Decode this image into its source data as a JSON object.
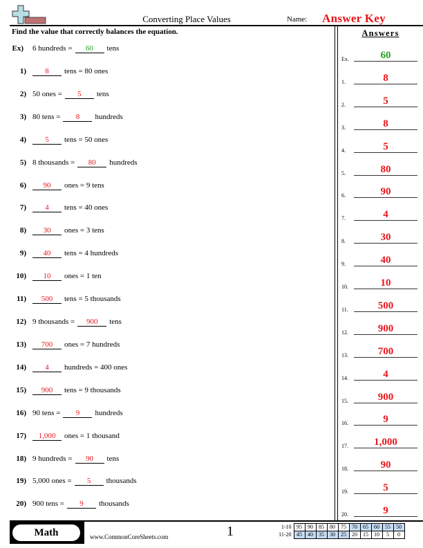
{
  "header": {
    "title": "Converting Place Values",
    "name_label": "Name:",
    "name_value": "Answer Key",
    "instructions": "Find the value that correctly balances the equation."
  },
  "colors": {
    "answer": "#e8151b",
    "example": "#23a323",
    "score_highlight": "#c6dcf5"
  },
  "problems": [
    {
      "num": "Ex)",
      "pre": "6 hundreds =",
      "answer": "60",
      "post": "tens",
      "blank_first": false
    },
    {
      "num": "1)",
      "pre": "",
      "answer": "8",
      "post": "tens = 80 ones",
      "blank_first": true
    },
    {
      "num": "2)",
      "pre": "50 ones =",
      "answer": "5",
      "post": "tens",
      "blank_first": false
    },
    {
      "num": "3)",
      "pre": "80 tens =",
      "answer": "8",
      "post": "hundreds",
      "blank_first": false
    },
    {
      "num": "4)",
      "pre": "",
      "answer": "5",
      "post": "tens = 50 ones",
      "blank_first": true
    },
    {
      "num": "5)",
      "pre": "8 thousands =",
      "answer": "80",
      "post": "hundreds",
      "blank_first": false
    },
    {
      "num": "6)",
      "pre": "",
      "answer": "90",
      "post": "ones = 9 tens",
      "blank_first": true
    },
    {
      "num": "7)",
      "pre": "",
      "answer": "4",
      "post": "tens = 40 ones",
      "blank_first": true
    },
    {
      "num": "8)",
      "pre": "",
      "answer": "30",
      "post": "ones = 3 tens",
      "blank_first": true
    },
    {
      "num": "9)",
      "pre": "",
      "answer": "40",
      "post": "tens = 4 hundreds",
      "blank_first": true
    },
    {
      "num": "10)",
      "pre": "",
      "answer": "10",
      "post": "ones = 1 ten",
      "blank_first": true
    },
    {
      "num": "11)",
      "pre": "",
      "answer": "500",
      "post": "tens = 5 thousands",
      "blank_first": true
    },
    {
      "num": "12)",
      "pre": "9 thousands =",
      "answer": "900",
      "post": "tens",
      "blank_first": false
    },
    {
      "num": "13)",
      "pre": "",
      "answer": "700",
      "post": "ones = 7 hundreds",
      "blank_first": true
    },
    {
      "num": "14)",
      "pre": "",
      "answer": "4",
      "post": "hundreds = 400 ones",
      "blank_first": true
    },
    {
      "num": "15)",
      "pre": "",
      "answer": "900",
      "post": "tens = 9 thousands",
      "blank_first": true
    },
    {
      "num": "16)",
      "pre": "90 tens =",
      "answer": "9",
      "post": "hundreds",
      "blank_first": false
    },
    {
      "num": "17)",
      "pre": "",
      "answer": "1,000",
      "post": "ones = 1 thousand",
      "blank_first": true
    },
    {
      "num": "18)",
      "pre": "9 hundreds =",
      "answer": "90",
      "post": "tens",
      "blank_first": false
    },
    {
      "num": "19)",
      "pre": "5,000 ones =",
      "answer": "5",
      "post": "thousands",
      "blank_first": false
    },
    {
      "num": "20)",
      "pre": "900 tens =",
      "answer": "9",
      "post": "thousands",
      "blank_first": false
    }
  ],
  "answers_panel": {
    "title": "Answers",
    "items": [
      {
        "label": "Ex.",
        "value": "60"
      },
      {
        "label": "1.",
        "value": "8"
      },
      {
        "label": "2.",
        "value": "5"
      },
      {
        "label": "3.",
        "value": "8"
      },
      {
        "label": "4.",
        "value": "5"
      },
      {
        "label": "5.",
        "value": "80"
      },
      {
        "label": "6.",
        "value": "90"
      },
      {
        "label": "7.",
        "value": "4"
      },
      {
        "label": "8.",
        "value": "30"
      },
      {
        "label": "9.",
        "value": "40"
      },
      {
        "label": "10.",
        "value": "10"
      },
      {
        "label": "11.",
        "value": "500"
      },
      {
        "label": "12.",
        "value": "900"
      },
      {
        "label": "13.",
        "value": "700"
      },
      {
        "label": "14.",
        "value": "4"
      },
      {
        "label": "15.",
        "value": "900"
      },
      {
        "label": "16.",
        "value": "9"
      },
      {
        "label": "17.",
        "value": "1,000"
      },
      {
        "label": "18.",
        "value": "90"
      },
      {
        "label": "19.",
        "value": "5"
      },
      {
        "label": "20.",
        "value": "9"
      }
    ]
  },
  "footer": {
    "subject": "Math",
    "website": "www.CommonCoreSheets.com",
    "page_number": "1",
    "score_table": [
      {
        "label": "1-10",
        "values": [
          "95",
          "90",
          "85",
          "80",
          "75",
          "70",
          "65",
          "60",
          "55",
          "50"
        ],
        "highlight": [
          false,
          false,
          false,
          false,
          false,
          true,
          true,
          true,
          true,
          true
        ]
      },
      {
        "label": "11-20",
        "values": [
          "45",
          "40",
          "35",
          "30",
          "25",
          "20",
          "15",
          "10",
          "5",
          "0"
        ],
        "highlight": [
          true,
          true,
          true,
          true,
          true,
          false,
          false,
          false,
          false,
          false
        ]
      }
    ]
  }
}
